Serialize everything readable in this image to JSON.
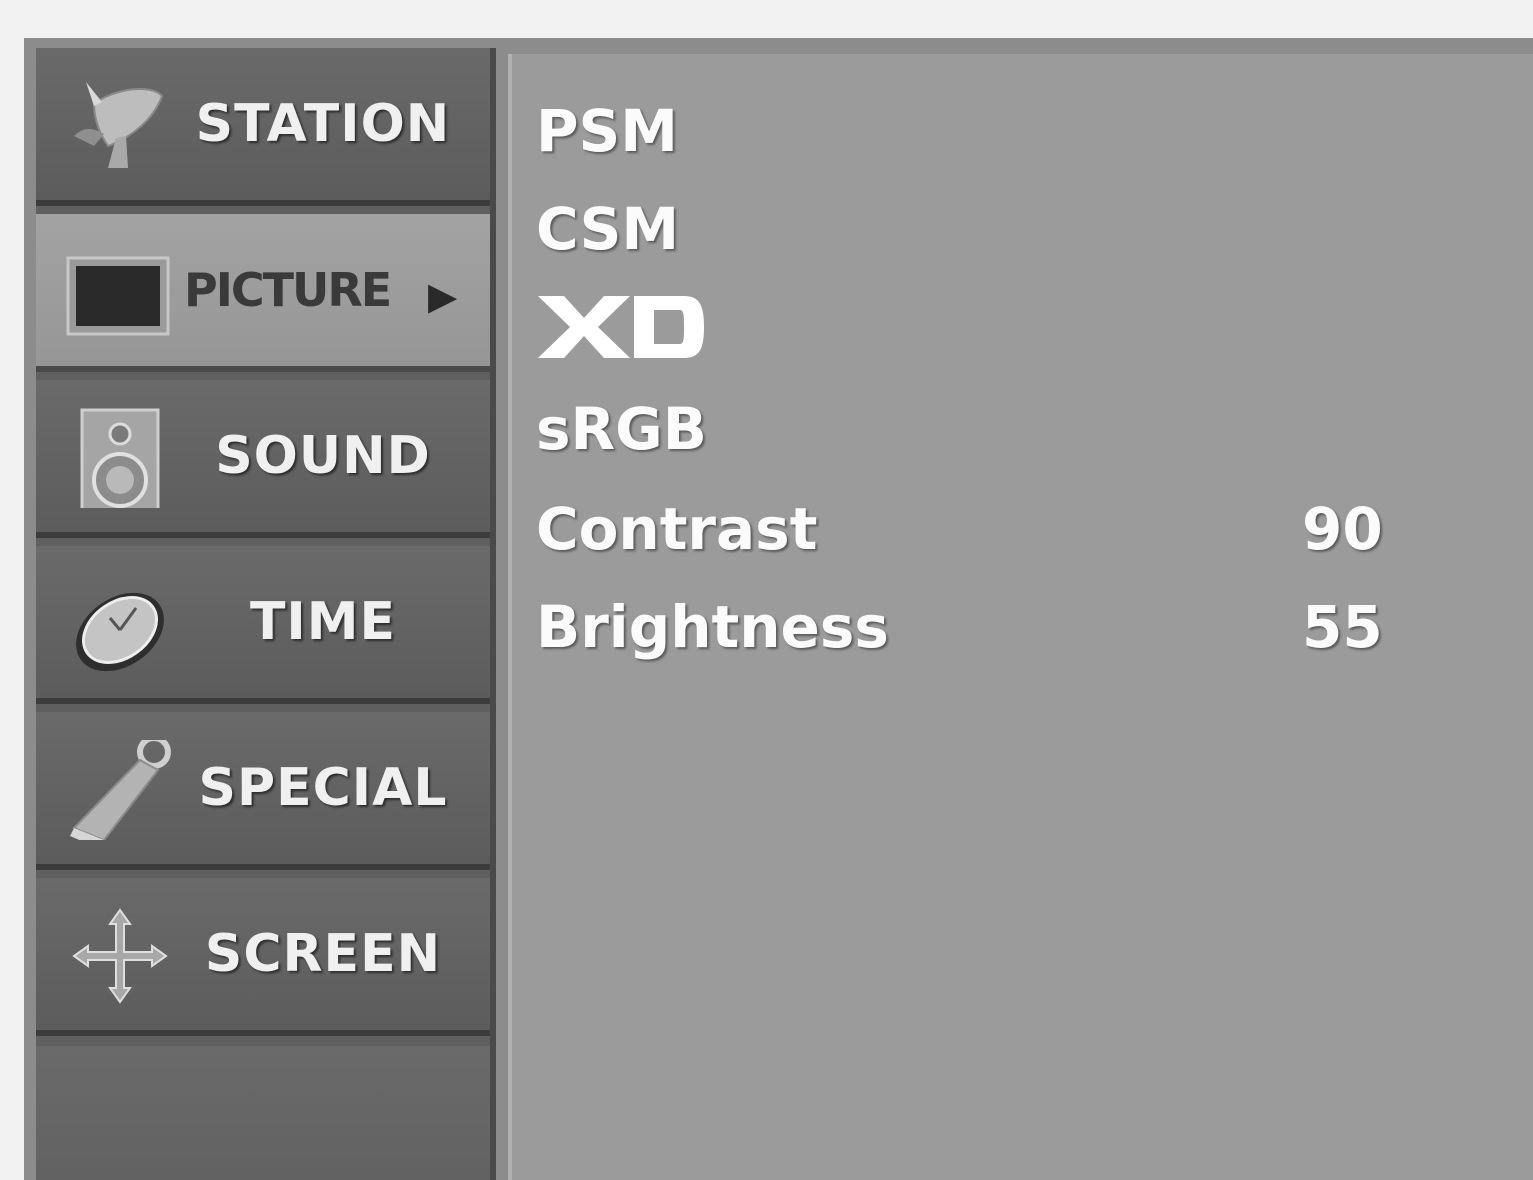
{
  "sidebar": {
    "items": [
      {
        "label": "STATION",
        "icon": "satellite-dish-icon",
        "selected": false
      },
      {
        "label": "PICTURE",
        "icon": "picture-screen-icon",
        "selected": true
      },
      {
        "label": "SOUND",
        "icon": "speaker-icon",
        "selected": false
      },
      {
        "label": "TIME",
        "icon": "clock-icon",
        "selected": false
      },
      {
        "label": "SPECIAL",
        "icon": "key-tag-icon",
        "selected": false
      },
      {
        "label": "SCREEN",
        "icon": "move-arrows-icon",
        "selected": false
      }
    ],
    "selected_arrow": "▶"
  },
  "picture_menu": {
    "psm": "PSM",
    "csm": "CSM",
    "xd": "XD",
    "srgb": "sRGB",
    "contrast": {
      "label": "Contrast",
      "value": "90"
    },
    "brightness": {
      "label": "Brightness",
      "value": "55"
    }
  },
  "colors": {
    "panel": "#9b9b9b",
    "sidebar": "#5f5f5f",
    "selected": "#a3a3a3",
    "text": "#fbfbfb"
  }
}
